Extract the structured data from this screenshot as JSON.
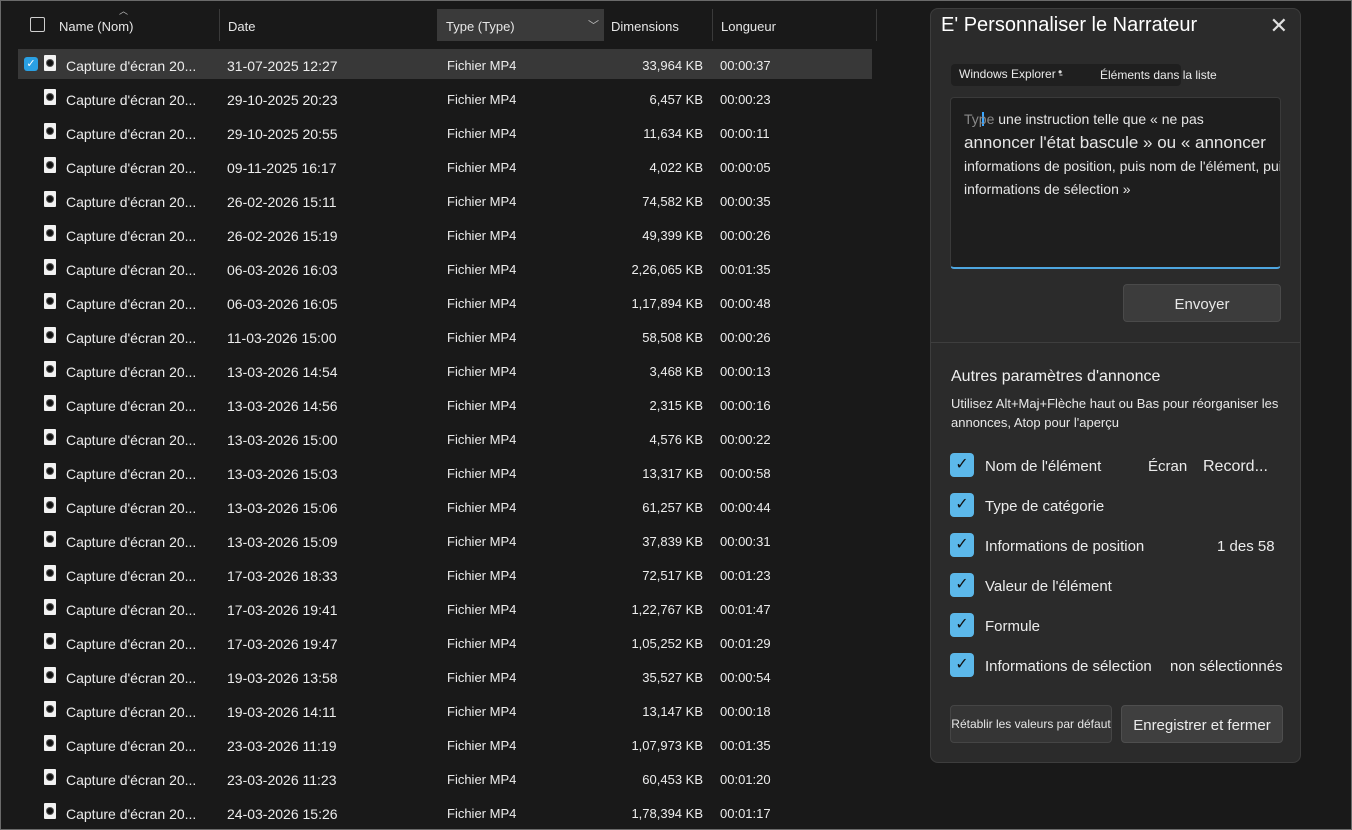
{
  "explorer": {
    "columns": {
      "name": "Name (Nom)",
      "date": "Date",
      "type": "Type (Type)",
      "size": "Dimensions",
      "length": "Longueur"
    },
    "files": [
      {
        "name": "Capture d'écran 20...",
        "date": "31-07-2025 12:27",
        "type": "Fichier MP4",
        "size": "33,964 KB",
        "length": "00:00:37",
        "selected": true
      },
      {
        "name": "Capture d'écran 20...",
        "date": "29-10-2025 20:23",
        "type": "Fichier MP4",
        "size": "6,457 KB",
        "length": "00:00:23"
      },
      {
        "name": "Capture d'écran 20...",
        "date": "29-10-2025 20:55",
        "type": "Fichier MP4",
        "size": "11,634 KB",
        "length": "00:00:11"
      },
      {
        "name": "Capture d'écran 20...",
        "date": "09-11-2025 16:17",
        "type": "Fichier MP4",
        "size": "4,022 KB",
        "length": "00:00:05"
      },
      {
        "name": "Capture d'écran 20...",
        "date": "26-02-2026 15:11",
        "type": "Fichier MP4",
        "size": "74,582 KB",
        "length": "00:00:35"
      },
      {
        "name": "Capture d'écran 20...",
        "date": "26-02-2026 15:19",
        "type": "Fichier MP4",
        "size": "49,399 KB",
        "length": "00:00:26"
      },
      {
        "name": "Capture d'écran 20...",
        "date": "06-03-2026 16:03",
        "type": "Fichier MP4",
        "size": "2,26,065 KB",
        "length": "00:01:35"
      },
      {
        "name": "Capture d'écran 20...",
        "date": "06-03-2026 16:05",
        "type": "Fichier MP4",
        "size": "1,17,894 KB",
        "length": "00:00:48"
      },
      {
        "name": "Capture d'écran 20...",
        "date": "11-03-2026 15:00",
        "type": "Fichier MP4",
        "size": "58,508 KB",
        "length": "00:00:26"
      },
      {
        "name": "Capture d'écran 20...",
        "date": "13-03-2026 14:54",
        "type": "Fichier MP4",
        "size": "3,468 KB",
        "length": "00:00:13"
      },
      {
        "name": "Capture d'écran 20...",
        "date": "13-03-2026 14:56",
        "type": "Fichier MP4",
        "size": "2,315 KB",
        "length": "00:00:16"
      },
      {
        "name": "Capture d'écran 20...",
        "date": "13-03-2026 15:00",
        "type": "Fichier MP4",
        "size": "4,576 KB",
        "length": "00:00:22"
      },
      {
        "name": "Capture d'écran 20...",
        "date": "13-03-2026 15:03",
        "type": "Fichier MP4",
        "size": "13,317 KB",
        "length": "00:00:58"
      },
      {
        "name": "Capture d'écran 20...",
        "date": "13-03-2026 15:06",
        "type": "Fichier MP4",
        "size": "61,257 KB",
        "length": "00:00:44"
      },
      {
        "name": "Capture d'écran 20...",
        "date": "13-03-2026 15:09",
        "type": "Fichier MP4",
        "size": "37,839 KB",
        "length": "00:00:31"
      },
      {
        "name": "Capture d'écran 20...",
        "date": "17-03-2026 18:33",
        "type": "Fichier MP4",
        "size": "72,517 KB",
        "length": "00:01:23"
      },
      {
        "name": "Capture d'écran 20...",
        "date": "17-03-2026 19:41",
        "type": "Fichier MP4",
        "size": "1,22,767 KB",
        "length": "00:01:47"
      },
      {
        "name": "Capture d'écran 20...",
        "date": "17-03-2026 19:47",
        "type": "Fichier MP4",
        "size": "1,05,252 KB",
        "length": "00:01:29"
      },
      {
        "name": "Capture d'écran 20...",
        "date": "19-03-2026 13:58",
        "type": "Fichier MP4",
        "size": "35,527 KB",
        "length": "00:00:54"
      },
      {
        "name": "Capture d'écran 20...",
        "date": "19-03-2026 14:11",
        "type": "Fichier MP4",
        "size": "13,147 KB",
        "length": "00:00:18"
      },
      {
        "name": "Capture d'écran 20...",
        "date": "23-03-2026 11:19",
        "type": "Fichier MP4",
        "size": "1,07,973 KB",
        "length": "00:01:35"
      },
      {
        "name": "Capture d'écran 20...",
        "date": "23-03-2026 11:23",
        "type": "Fichier MP4",
        "size": "60,453 KB",
        "length": "00:01:20"
      },
      {
        "name": "Capture d'écran 20...",
        "date": "24-03-2026 15:26",
        "type": "Fichier MP4",
        "size": "1,78,394 KB",
        "length": "00:01:17"
      }
    ]
  },
  "narrator": {
    "title": "E' Personnaliser le Narrateur",
    "close_icon": "close-icon",
    "context": {
      "app": "Windows Explorer -",
      "list": "Éléments dans la liste"
    },
    "instruction": {
      "placeholder_word": "Type",
      "line1": " une instruction telle que « ne pas",
      "line2": "annoncer l'état bascule » ou « annoncer",
      "line3": "informations de position, puis nom de l'élément, puis",
      "line4": "informations de sélection »"
    },
    "send_label": "Envoyer",
    "other_title": "Autres paramètres d'annonce",
    "other_desc": "Utilisez Alt+Maj+Flèche haut ou Bas pour réorganiser les annonces, Atop pour l'aperçu",
    "options": [
      {
        "label": "Nom de l'élément",
        "value": "Écran",
        "value2": "Record..."
      },
      {
        "label": "Type de catégorie",
        "value": "",
        "value2": ""
      },
      {
        "label": "Informations de position",
        "value": "1 des 58",
        "value2": ""
      },
      {
        "label": "Valeur de l'élément",
        "value": "",
        "value2": ""
      },
      {
        "label": "Formule",
        "value": "",
        "value2": ""
      },
      {
        "label": "Informations de sélection",
        "value": "non sélectionnés",
        "value2": ""
      }
    ],
    "reset_label": "Rétablir les valeurs par défaut",
    "save_label": "Enregistrer et fermer",
    "accent_color": "#5cb8ea"
  }
}
